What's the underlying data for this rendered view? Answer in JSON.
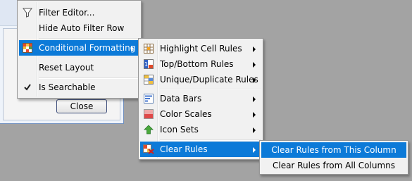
{
  "close_button": {
    "label": "Close"
  },
  "column_menu": {
    "items": [
      {
        "label": "Filter Editor...",
        "icon": "funnel-icon"
      },
      {
        "label": "Hide Auto Filter Row"
      },
      {
        "label": "Conditional Formatting",
        "icon": "conditional-formatting-icon",
        "highlighted": true,
        "has_submenu": true
      },
      {
        "label": "Reset Layout"
      },
      {
        "label": "Is Searchable",
        "icon": "checkmark-icon",
        "checked": true
      }
    ]
  },
  "conditional_formatting_menu": {
    "items": [
      {
        "label": "Highlight Cell Rules",
        "icon": "highlight-cell-rules-icon",
        "has_submenu": true
      },
      {
        "label": "Top/Bottom Rules",
        "icon": "top-bottom-rules-icon",
        "has_submenu": true
      },
      {
        "label": "Unique/Duplicate Rules",
        "icon": "unique-duplicate-rules-icon",
        "has_submenu": true
      },
      {
        "label": "Data Bars",
        "icon": "data-bars-icon",
        "has_submenu": true
      },
      {
        "label": "Color Scales",
        "icon": "color-scales-icon",
        "has_submenu": true
      },
      {
        "label": "Icon Sets",
        "icon": "icon-sets-icon",
        "has_submenu": true
      },
      {
        "label": "Clear Rules",
        "icon": "clear-rules-icon",
        "has_submenu": true,
        "highlighted": true
      }
    ]
  },
  "clear_rules_menu": {
    "items": [
      {
        "label": "Clear Rules from This Column",
        "highlighted": true
      },
      {
        "label": "Clear Rules from All Columns"
      }
    ]
  },
  "colors": {
    "highlight": "#0c7ad8",
    "menu_background": "#f1f1f1",
    "desktop_background": "#a3a3a3"
  }
}
